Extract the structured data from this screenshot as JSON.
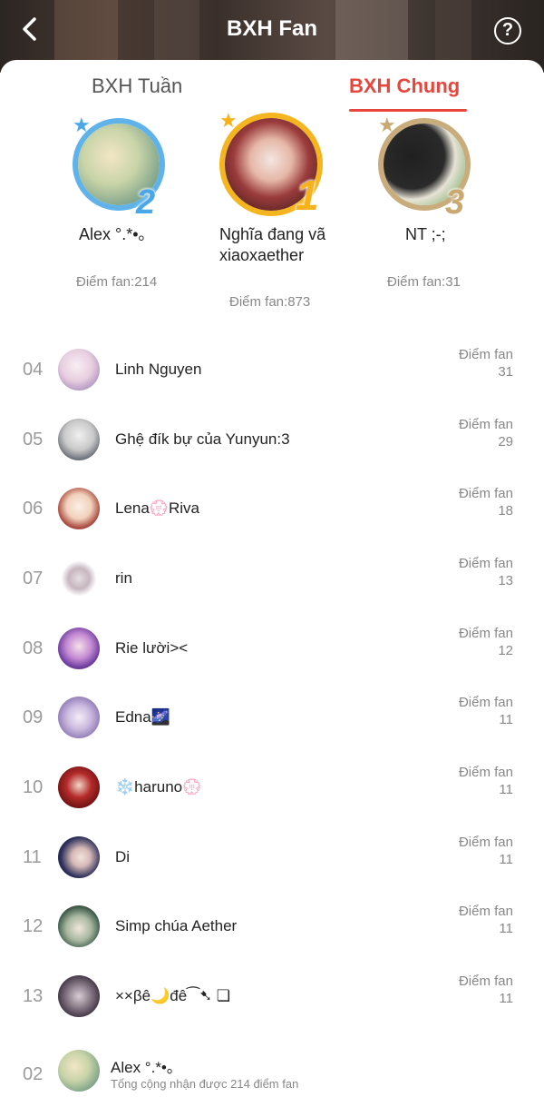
{
  "header": {
    "title": "BXH Fan",
    "back_icon": "chevron-left-icon",
    "help_icon": "question-circle-icon",
    "help_glyph": "?"
  },
  "tabs": [
    {
      "label": "BXH Tuần",
      "active": false
    },
    {
      "label": "BXH Chung",
      "active": true
    }
  ],
  "accent_color": "#e8453c",
  "podium": [
    {
      "rank": "2",
      "name": "Alex °.*•｡",
      "score": "Điểm fan:214",
      "ring_color": "#5fb3ea"
    },
    {
      "rank": "1",
      "name": "Nghĩa đang vã xiaoxaether",
      "score": "Điểm fan:873",
      "ring_color": "#f5b51f"
    },
    {
      "rank": "3",
      "name": "NT ;-;",
      "score": "Điểm fan:31",
      "ring_color": "#c9ac7b"
    }
  ],
  "score_label": "Điểm fan",
  "list": [
    {
      "rank": "04",
      "name": "Linh Nguyen",
      "score": "31"
    },
    {
      "rank": "05",
      "name": "Ghệ đík bự của Yunyun:3",
      "score": "29"
    },
    {
      "rank": "06",
      "name": "Lena💮Riva",
      "score": "18"
    },
    {
      "rank": "07",
      "name": "rin",
      "score": "13"
    },
    {
      "rank": "08",
      "name": "Rie lười><",
      "score": "12"
    },
    {
      "rank": "09",
      "name": "Edna🌌",
      "score": "11"
    },
    {
      "rank": "10",
      "name": "❄️haruno💮",
      "score": "11"
    },
    {
      "rank": "11",
      "name": "Di",
      "score": "11"
    },
    {
      "rank": "12",
      "name": "Simp chúa Aether",
      "score": "11"
    },
    {
      "rank": "13",
      "name": "××βê🌙đê⁀➷ ❏",
      "score": "11"
    }
  ],
  "my_rank": {
    "rank": "02",
    "name": "Alex °.*•｡",
    "total": "Tổng cộng nhận được 214 điểm fan"
  }
}
